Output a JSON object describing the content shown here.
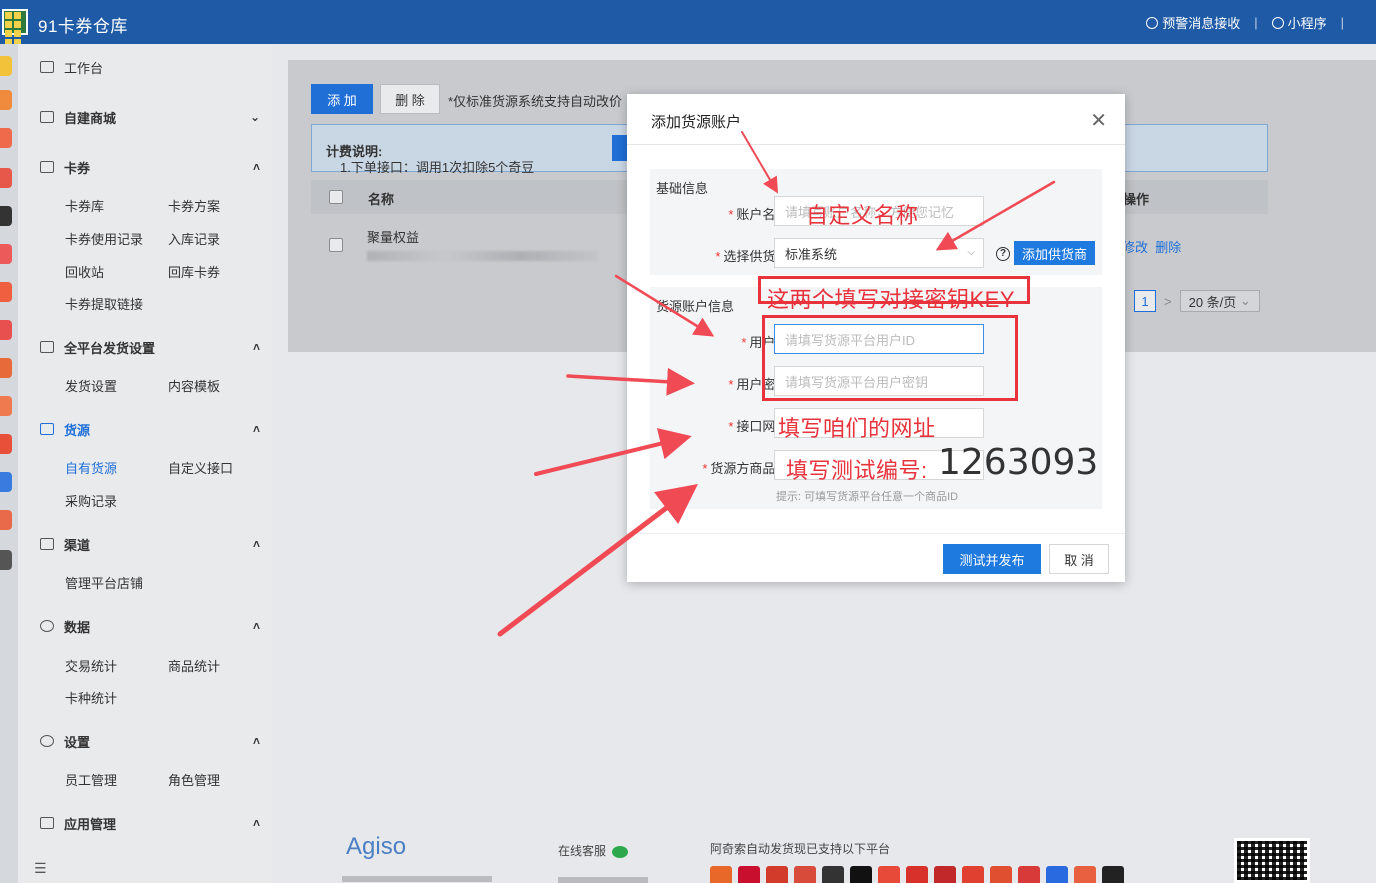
{
  "topbar": {
    "app_title": "91卡券仓库",
    "alert_label": "预警消息接收",
    "miniapp_label": "小程序"
  },
  "sidebar": {
    "workbench": "工作台",
    "mall": "自建商城",
    "coupon": {
      "title": "卡券",
      "items": [
        "卡券库",
        "卡券方案",
        "卡券使用记录",
        "入库记录",
        "回收站",
        "回库卡券",
        "卡券提取链接"
      ]
    },
    "delivery": {
      "title": "全平台发货设置",
      "items": [
        "发货设置",
        "内容模板"
      ]
    },
    "source": {
      "title": "货源",
      "items": [
        "自有货源",
        "自定义接口",
        "采购记录"
      ]
    },
    "channel": {
      "title": "渠道",
      "items": [
        "管理平台店铺"
      ]
    },
    "stats": {
      "title": "数据",
      "items": [
        "交易统计",
        "商品统计",
        "卡种统计"
      ]
    },
    "settings": {
      "title": "设置",
      "items": [
        "员工管理",
        "角色管理"
      ]
    },
    "apps": {
      "title": "应用管理"
    }
  },
  "main": {
    "add_label": "添 加",
    "delete_label": "删 除",
    "note": "*仅标准货源系统支持自动改价",
    "billing_label": "计费说明:",
    "billing_text": "1.下单接口：调用1次扣除5个奇豆",
    "col_name": "名称",
    "col_op": "操作",
    "row_name": "聚量权益",
    "row_edit": "修改",
    "row_delete": "删除",
    "page_current": "1",
    "page_size": "20 条/页"
  },
  "footer": {
    "brand": "Agiso",
    "customer_service": "在线客服",
    "platforms_text": "阿奇索自动发货现已支持以下平台"
  },
  "modal": {
    "title": "添加货源账户",
    "section_basic": "基础信息",
    "account_name_label": "账户名称:",
    "account_name_placeholder": "请填写账户名称，方便您记忆",
    "supplier_label": "选择供货商:",
    "supplier_value": "标准系统",
    "add_supplier_label": "添加供货商",
    "section_account": "货源账户信息",
    "user_id_label": "用户ID:",
    "user_id_placeholder": "请填写货源平台用户ID",
    "user_key_label": "用户密钥:",
    "user_key_placeholder": "请填写货源平台用户密钥",
    "gateway_label": "接口网关:",
    "gateway_placeholder": "",
    "product_id_label": "货源方商品ID:",
    "product_id_placeholder": "",
    "product_id_hint": "提示: 可填写货源平台任意一个商品ID",
    "test_publish_label": "测试并发布",
    "cancel_label": "取 消"
  },
  "annotations": {
    "custom_name": "自定义名称",
    "fill_keys": "这两个填写对接密钥KEY",
    "fill_url": "填写咱们的网址",
    "fill_test_id": "填写测试编号:",
    "test_number": "1263093"
  },
  "colors": {
    "topbar": "#1e5aa6",
    "primary": "#1f7ae0",
    "annotation": "#e8323c"
  }
}
